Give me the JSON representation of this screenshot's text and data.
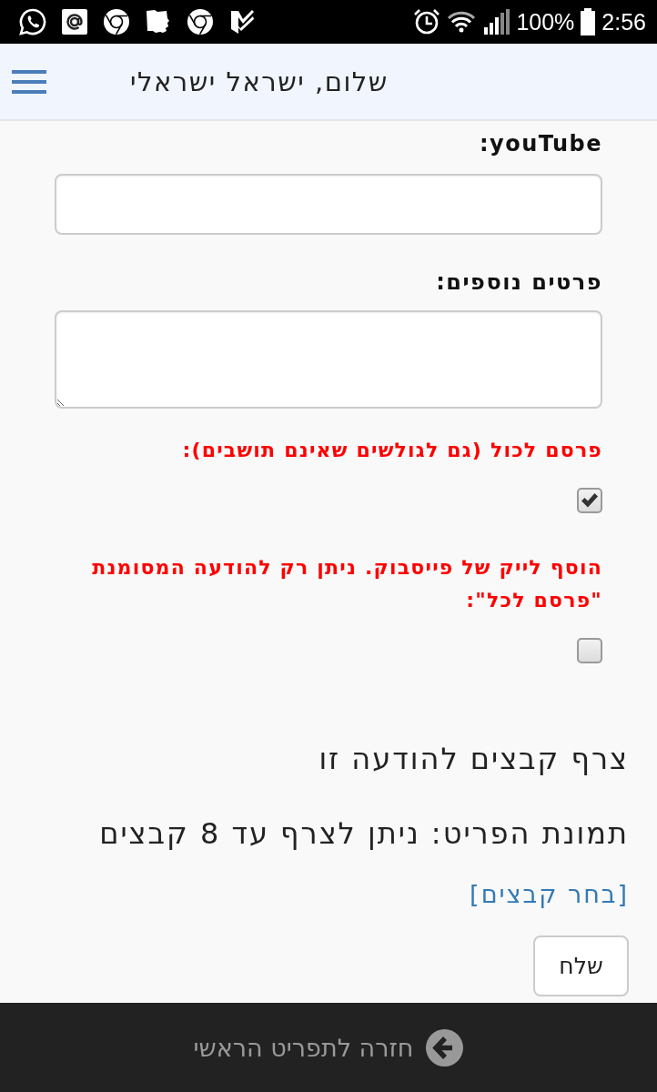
{
  "status_bar": {
    "battery": "100%",
    "time": "2:56"
  },
  "header": {
    "title": "שלום, ישראל ישראלי"
  },
  "fields": [
    {
      "kind": "input",
      "label": "youTube:"
    },
    {
      "kind": "textarea",
      "label": "פרטים נוספים:"
    }
  ],
  "options": [
    {
      "label": "פרסם לכול (גם לגולשים שאינם תושבים):",
      "checked": true
    },
    {
      "label": "הוסף לייק של פייסבוק. ניתן רק להודעה המסומנת \"פרסם לכל\":",
      "checked": false
    }
  ],
  "attachments": {
    "title": "צרף קבצים להודעה זו",
    "note": "תמונת הפריט: ניתן לצרף עד 8 קבצים",
    "link": "[בחר קבצים]"
  },
  "submit_button": "שלח",
  "footer": {
    "link": "חזרה לתפריט הראשי"
  }
}
